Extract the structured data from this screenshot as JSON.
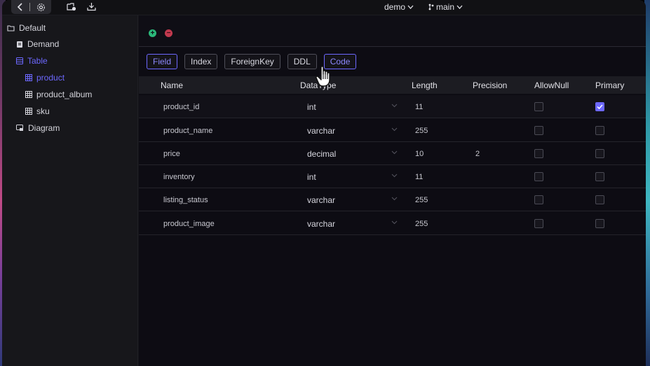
{
  "titlebar": {
    "back_icon": "chevron-left-icon",
    "settings_icon": "gear-icon",
    "new_file_icon": "new-folder-icon",
    "download_icon": "download-icon",
    "database_selector": "demo",
    "branch_selector": "main"
  },
  "sidebar": {
    "root": "Default",
    "items": [
      {
        "label": "Demand",
        "icon": "document-icon"
      },
      {
        "label": "Table",
        "icon": "table-icon"
      },
      {
        "label": "product",
        "icon": "grid-icon"
      },
      {
        "label": "product_album",
        "icon": "grid-icon"
      },
      {
        "label": "sku",
        "icon": "grid-icon"
      },
      {
        "label": "Diagram",
        "icon": "diagram-icon"
      }
    ]
  },
  "toolbar": {
    "add_icon": "plus-circle-icon",
    "remove_icon": "minus-circle-icon"
  },
  "tabs": [
    "Field",
    "Index",
    "ForeignKey",
    "DDL",
    "Code"
  ],
  "columns": {
    "name": "Name",
    "datatype": "DataType",
    "length": "Length",
    "precision": "Precision",
    "allownull": "AllowNull",
    "primary": "Primary"
  },
  "rows": [
    {
      "name": "product_id",
      "type": "int",
      "length": "11",
      "precision": "",
      "allownull": false,
      "primary": true
    },
    {
      "name": "product_name",
      "type": "varchar",
      "length": "255",
      "precision": "",
      "allownull": false,
      "primary": false
    },
    {
      "name": "price",
      "type": "decimal",
      "length": "10",
      "precision": "2",
      "allownull": false,
      "primary": false
    },
    {
      "name": "inventory",
      "type": "int",
      "length": "11",
      "precision": "",
      "allownull": false,
      "primary": false
    },
    {
      "name": "listing_status",
      "type": "varchar",
      "length": "255",
      "precision": "",
      "allownull": false,
      "primary": false
    },
    {
      "name": "product_image",
      "type": "varchar",
      "length": "255",
      "precision": "",
      "allownull": false,
      "primary": false
    }
  ],
  "colors": {
    "accent": "#6d68ff",
    "add": "#2bb87a",
    "remove": "#c23a4f"
  }
}
